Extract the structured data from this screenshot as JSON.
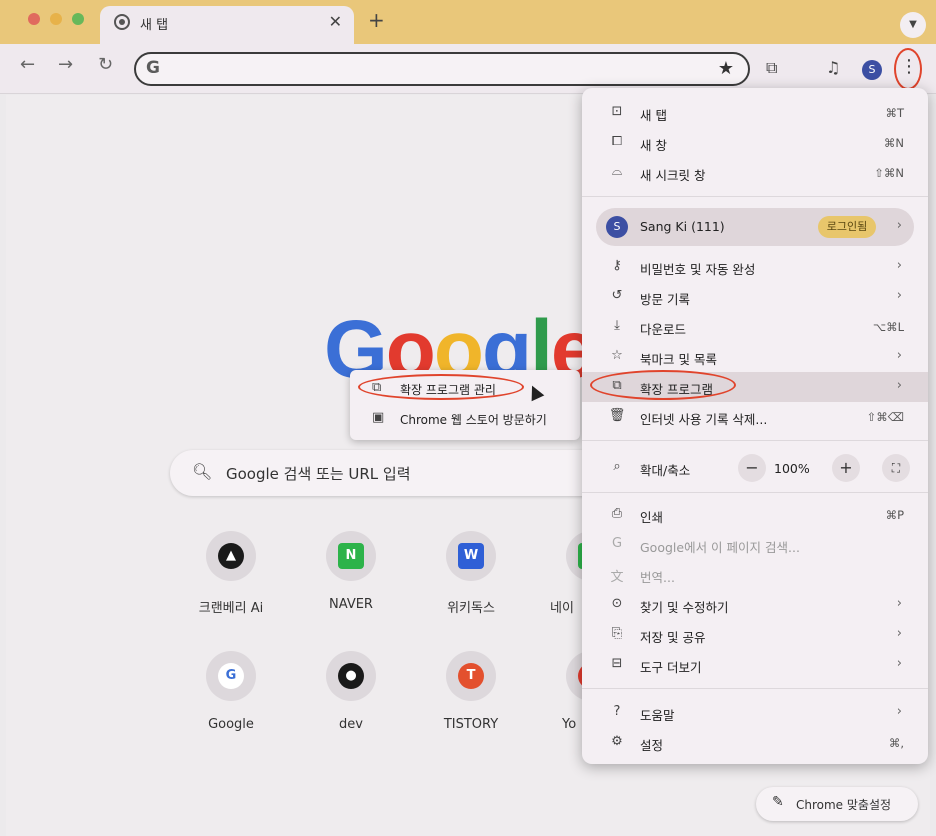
{
  "tab": {
    "title": "새 탭",
    "close": "✕",
    "new_tab": "+"
  },
  "toolbar": {
    "back": "←",
    "forward": "→",
    "reload": "↻",
    "omni_g": "G",
    "star": "★",
    "menu": "⋮",
    "profile_initial": "S"
  },
  "ntp": {
    "search_placeholder": "Google 검색 또는 URL 입력",
    "customize_label": "Chrome 맞춤설정",
    "shortcuts": [
      {
        "label": "크랜베리 Ai",
        "glyph": "▲",
        "color": "#1a1a1a"
      },
      {
        "label": "NAVER",
        "glyph": "N",
        "color": "#2db34a"
      },
      {
        "label": "위키독스",
        "glyph": "W",
        "color": "#2f5fd6"
      },
      {
        "label": "네이",
        "glyph": "N",
        "color": "#2db34a"
      },
      {
        "label": "Google",
        "glyph": "G",
        "color": "#ffffff"
      },
      {
        "label": "dev",
        "glyph": "●",
        "color": "#1a1a1a"
      },
      {
        "label": "TISTORY",
        "glyph": "T",
        "color": "#e3502e"
      },
      {
        "label": "Yo",
        "glyph": "▶",
        "color": "#e23a2e"
      }
    ]
  },
  "submenu": {
    "items": [
      {
        "label": "확장 프로그램 관리"
      },
      {
        "label": "Chrome 웹 스토어 방문하기"
      }
    ]
  },
  "menu": {
    "new_tab": {
      "label": "새 탭",
      "shortcut": "⌘T"
    },
    "new_window": {
      "label": "새 창",
      "shortcut": "⌘N"
    },
    "incognito": {
      "label": "새 시크릿 창",
      "shortcut": "⇧⌘N"
    },
    "profile": {
      "initial": "S",
      "name": "Sang Ki (111)",
      "badge": "로그인됨"
    },
    "passwords": {
      "label": "비밀번호 및 자동 완성"
    },
    "history": {
      "label": "방문 기록"
    },
    "downloads": {
      "label": "다운로드",
      "shortcut": "⌥⌘L"
    },
    "bookmarks": {
      "label": "북마크 및 목록"
    },
    "extensions": {
      "label": "확장 프로그램"
    },
    "clear_data": {
      "label": "인터넷 사용 기록 삭제...",
      "shortcut": "⇧⌘⌫"
    },
    "zoom": {
      "label": "확대/축소",
      "value": "100%",
      "minus": "−",
      "plus": "+"
    },
    "print": {
      "label": "인쇄",
      "shortcut": "⌘P"
    },
    "search_page": {
      "label": "Google에서 이 페이지 검색..."
    },
    "translate": {
      "label": "번역..."
    },
    "find_edit": {
      "label": "찾기 및 수정하기"
    },
    "save_share": {
      "label": "저장 및 공유"
    },
    "more_tools": {
      "label": "도구 더보기"
    },
    "help": {
      "label": "도움말"
    },
    "settings": {
      "label": "설정",
      "shortcut": "⌘,"
    }
  }
}
